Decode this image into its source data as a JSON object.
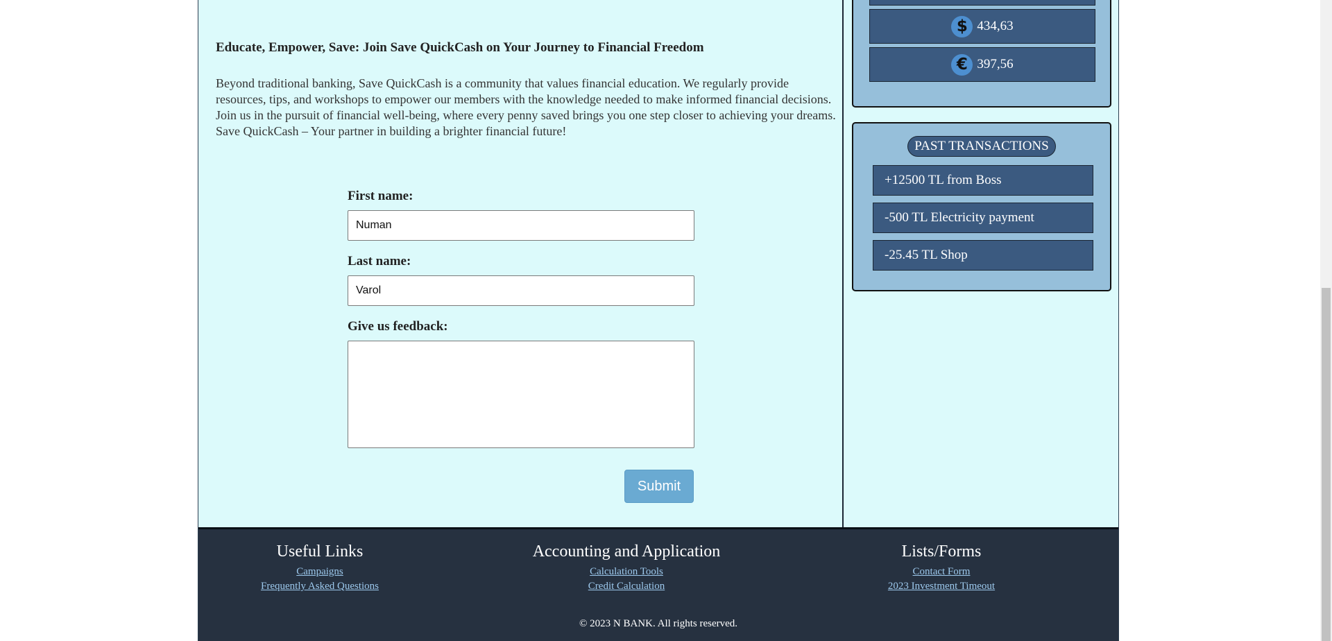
{
  "main": {
    "headline": "Educate, Empower, Save: Join Save QuickCash on Your Journey to Financial Freedom",
    "paragraph": "Beyond traditional banking, Save QuickCash is a community that values financial education. We regularly provide resources, tips, and workshops to empower our members with the knowledge needed to make informed financial decisions. Join us in the pursuit of financial well-being, where every penny saved brings you one step closer to achieving your dreams. Save QuickCash – Your partner in building a brighter financial future!"
  },
  "form": {
    "first_name_label": "First name:",
    "first_name_value": "Numan",
    "last_name_label": "Last name:",
    "last_name_value": "Varol",
    "feedback_label": "Give us feedback:",
    "feedback_value": "",
    "submit_label": "Submit"
  },
  "sidebar": {
    "balances": [
      {
        "currency_icon": "dollar-icon",
        "symbol": "$",
        "amount": "434,63"
      },
      {
        "currency_icon": "euro-icon",
        "symbol": "€",
        "amount": "397,56"
      }
    ],
    "transactions_title": "PAST TRANSACTIONS",
    "transactions": [
      "+12500 TL from Boss",
      "-500 TL Electricity payment",
      "-25.45 TL Shop"
    ]
  },
  "footer": {
    "columns": [
      {
        "title": "Useful Links",
        "links": [
          "Campaigns",
          "Frequently Asked Questions"
        ]
      },
      {
        "title": "Accounting and Application",
        "links": [
          "Calculation Tools",
          "Credit Calculation"
        ]
      },
      {
        "title": "Lists/Forms",
        "links": [
          "Contact Form",
          "2023 Investment Timeout"
        ]
      }
    ],
    "copyright": "© 2023 N BANK. All rights reserved."
  },
  "colors": {
    "page_bg": "#dcfafb",
    "panel_bg": "#96bfda",
    "card_bg": "#3b5a80",
    "footer_bg": "#263140",
    "submit_bg": "#6aaad2",
    "link": "#9dc9ed"
  }
}
